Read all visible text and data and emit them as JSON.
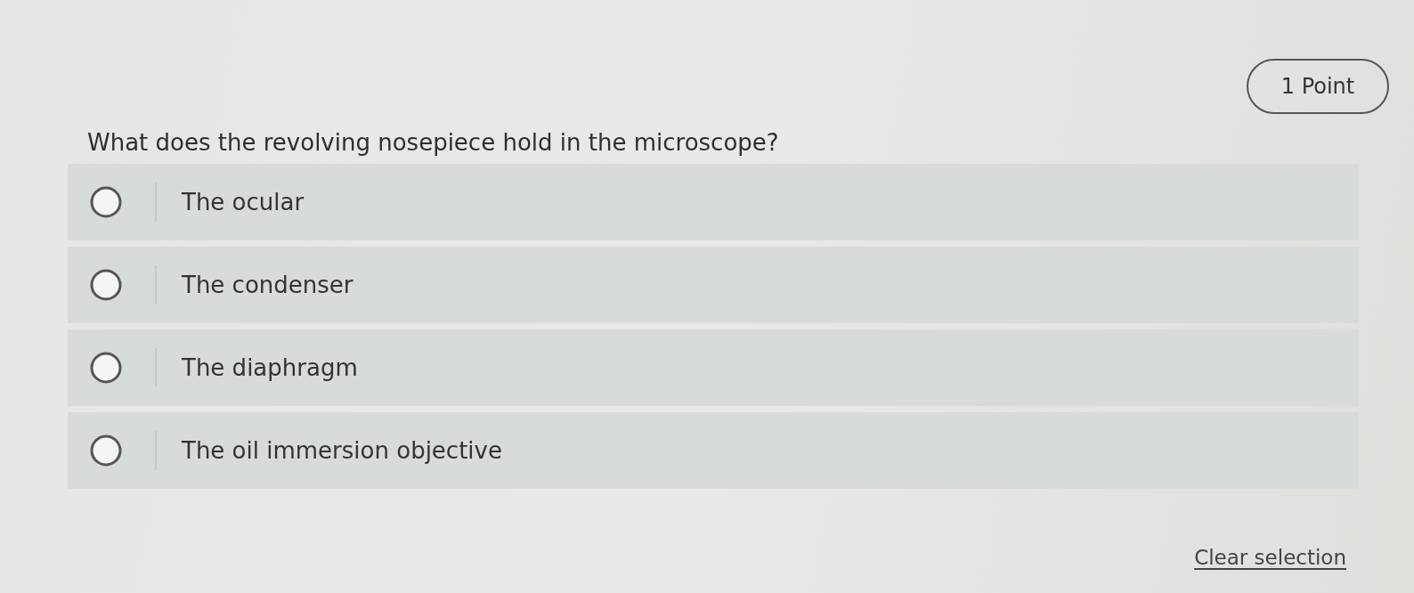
{
  "points_badge": "1 Point",
  "question": "What does the revolving nosepiece hold in the microscope?",
  "options": [
    {
      "label": "The ocular",
      "selected": false
    },
    {
      "label": "The condenser",
      "selected": false
    },
    {
      "label": "The diaphragm",
      "selected": false
    },
    {
      "label": "The oil immersion objective",
      "selected": false
    }
  ],
  "clear_link": "Clear selection"
}
